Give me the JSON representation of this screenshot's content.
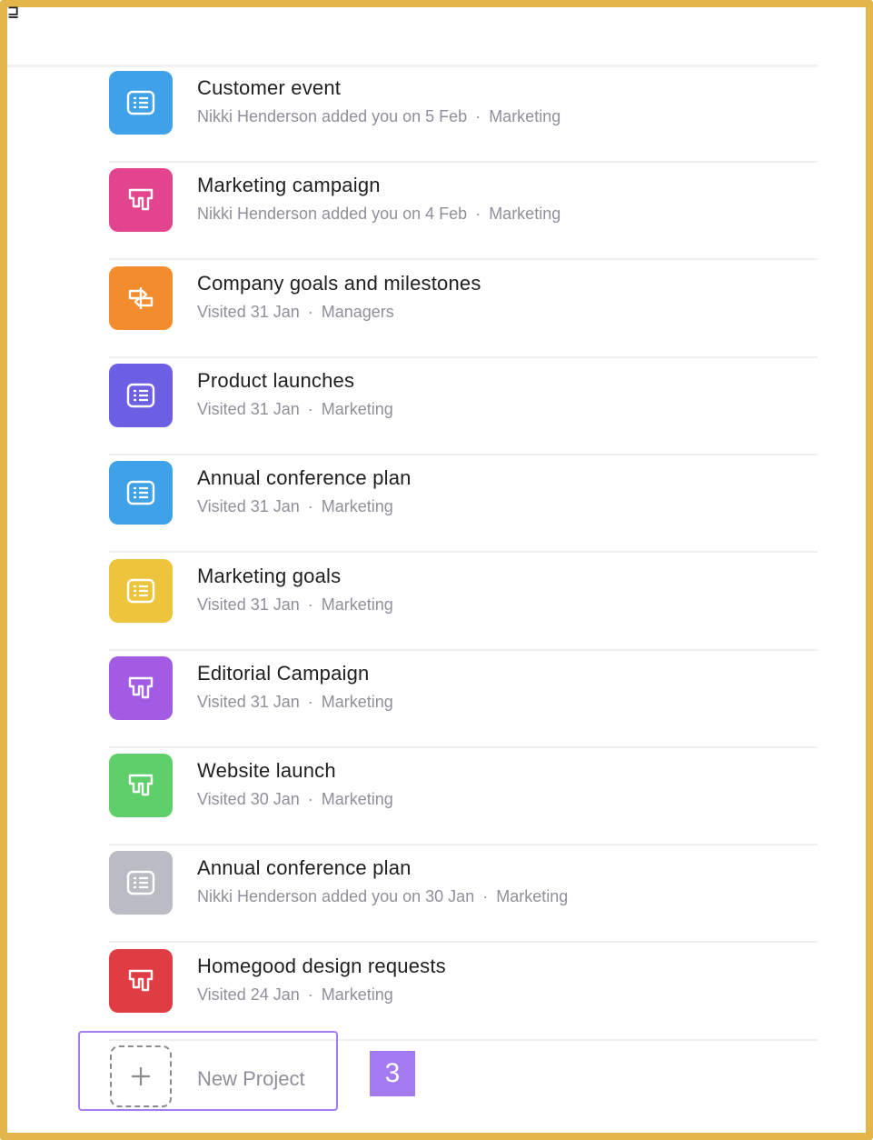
{
  "header": {
    "corner_glyph": "⊒"
  },
  "projects": [
    {
      "title": "Customer event",
      "meta_left": "Nikki Henderson added you on 5 Feb",
      "meta_right": "Marketing",
      "color": "#3fa1e8",
      "icon": "list-icon"
    },
    {
      "title": "Marketing campaign",
      "meta_left": "Nikki Henderson added you on 4 Feb",
      "meta_right": "Marketing",
      "color": "#e2458e",
      "icon": "board-icon"
    },
    {
      "title": "Company goals and milestones",
      "meta_left": "Visited 31 Jan",
      "meta_right": "Managers",
      "color": "#f28c2c",
      "icon": "timeline-icon"
    },
    {
      "title": "Product launches",
      "meta_left": "Visited 31 Jan",
      "meta_right": "Marketing",
      "color": "#6c5fe4",
      "icon": "list-icon"
    },
    {
      "title": "Annual conference plan",
      "meta_left": "Visited 31 Jan",
      "meta_right": "Marketing",
      "color": "#3fa1e8",
      "icon": "list-icon"
    },
    {
      "title": "Marketing goals",
      "meta_left": "Visited 31 Jan",
      "meta_right": "Marketing",
      "color": "#ecc53c",
      "icon": "list-icon"
    },
    {
      "title": "Editorial Campaign",
      "meta_left": "Visited 31 Jan",
      "meta_right": "Marketing",
      "color": "#a45be4",
      "icon": "board-icon"
    },
    {
      "title": "Website launch",
      "meta_left": "Visited 30 Jan",
      "meta_right": "Marketing",
      "color": "#5fcf6a",
      "icon": "board-icon"
    },
    {
      "title": "Annual conference plan",
      "meta_left": "Nikki Henderson added you on 30 Jan",
      "meta_right": "Marketing",
      "color": "#b9bcc2",
      "icon": "list-icon"
    },
    {
      "title": "Homegood design requests",
      "meta_left": "Visited 24 Jan",
      "meta_right": "Marketing",
      "color": "#e03c43",
      "icon": "board-icon"
    }
  ],
  "new_project": {
    "label": "New Project"
  },
  "step_badge": {
    "number": "3"
  },
  "colors": {
    "frame": "#e2b64a",
    "highlight": "#a57cf2"
  }
}
